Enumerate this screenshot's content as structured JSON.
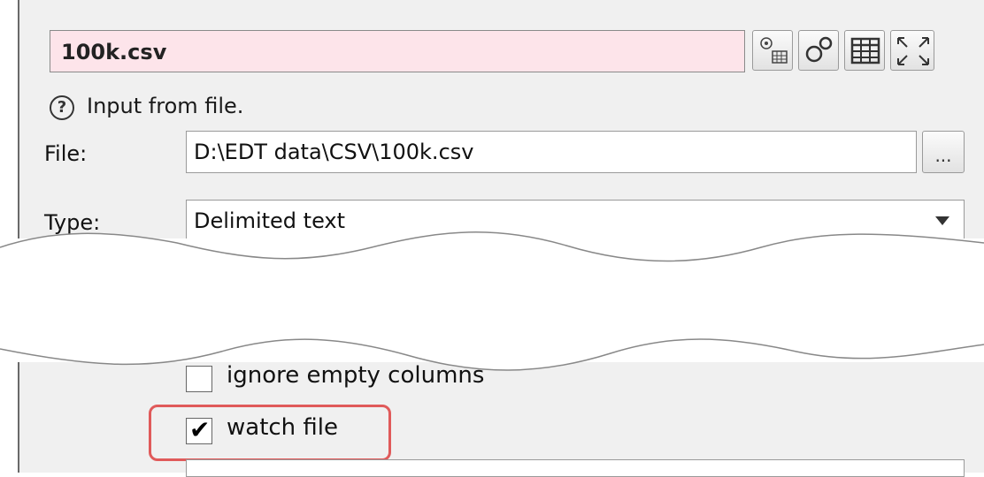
{
  "header": {
    "title": "100k.csv",
    "toolbar": [
      {
        "icon": "gear-table-icon"
      },
      {
        "icon": "gears-icon"
      },
      {
        "icon": "table-icon"
      },
      {
        "icon": "maximize-icon"
      }
    ]
  },
  "help": {
    "icon": "question-icon",
    "text": "Input from file."
  },
  "fields": {
    "file_label": "File:",
    "file_value": "D:\\EDT data\\CSV\\100k.csv",
    "browse_label": "...",
    "type_label": "Type:",
    "type_value": "Delimited text"
  },
  "options": {
    "ignore_empty_columns": {
      "label": "ignore empty columns",
      "checked": false
    },
    "watch_file": {
      "label": "watch file",
      "checked": true
    }
  },
  "colors": {
    "title_bg": "#fde4ea",
    "highlight": "#e05a5a",
    "panel_bg": "#f0f0f0"
  }
}
